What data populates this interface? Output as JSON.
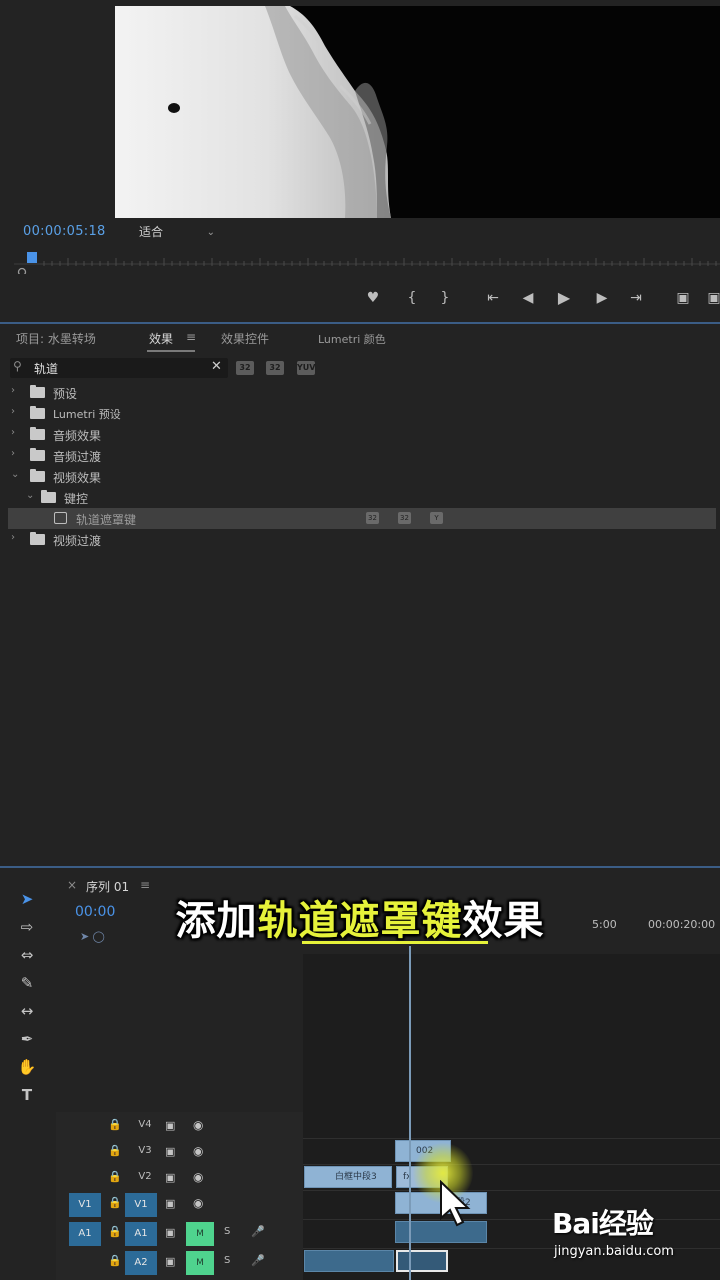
{
  "program_monitor": {
    "timecode": "00:00:05:18",
    "fit": "适合"
  },
  "effects_panel": {
    "tabs": [
      "项目: 水墨转场",
      "效果",
      "效果控件",
      "Lumetri 颜色"
    ],
    "active_tab": "效果",
    "search": {
      "value": "轨道"
    },
    "tree": [
      {
        "label": "预设",
        "expanded": false
      },
      {
        "label": "Lumetri 预设",
        "expanded": false
      },
      {
        "label": "音频效果",
        "expanded": false
      },
      {
        "label": "音频过渡",
        "expanded": false
      },
      {
        "label": "视频效果",
        "expanded": true
      },
      {
        "label": "键控",
        "expanded": true
      },
      {
        "label": "轨道遮罩键",
        "selected": true
      },
      {
        "label": "视频过渡",
        "expanded": false
      }
    ]
  },
  "timeline": {
    "sequence_name": "序列 01",
    "timecode": "00:00",
    "ruler_labels": [
      "00:00:20:00"
    ],
    "ruler_mid": "5:00",
    "tracks": [
      {
        "name": "V4"
      },
      {
        "name": "V3"
      },
      {
        "name": "V2"
      },
      {
        "name": "V1",
        "source": "V1"
      },
      {
        "name": "A1",
        "source": "A1",
        "mute": "M",
        "solo": "S"
      },
      {
        "name": "A2",
        "mute": "M",
        "solo": "S"
      }
    ],
    "clips": {
      "v3": "002",
      "v2_left": "白框中段3",
      "v2": "fx",
      "v1": "段2"
    }
  },
  "caption": {
    "prefix": "添加",
    "highlight": "轨道遮罩键",
    "suffix": "效果"
  },
  "watermark": {
    "logo": "Bai经验",
    "url": "jingyan.baidu.com"
  },
  "colors": {
    "accent_blue": "#4a93e8",
    "caption_yellow": "#e6f23a",
    "clip_blue": "#8fb3d4",
    "mute_green": "#4fd38e"
  }
}
